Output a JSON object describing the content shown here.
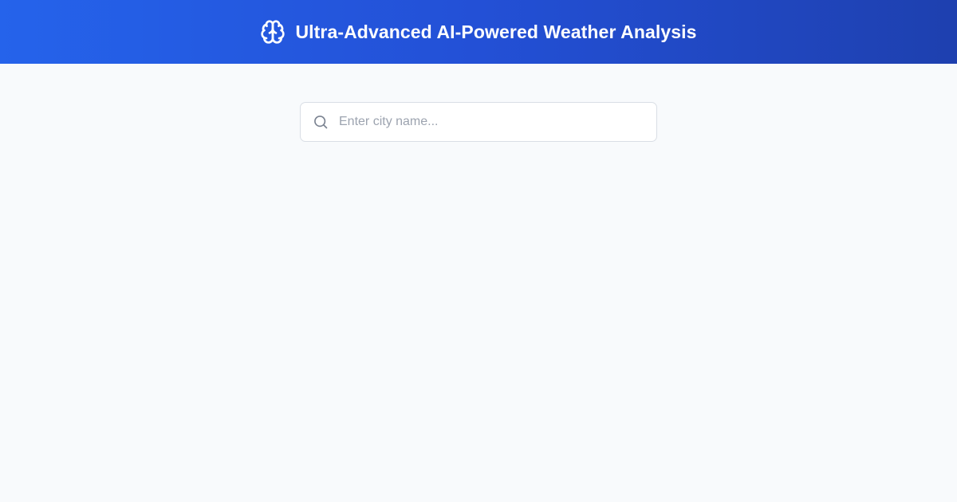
{
  "header": {
    "title": "Ultra-Advanced AI-Powered Weather Analysis",
    "icon": "brain-icon"
  },
  "search": {
    "icon": "search-icon",
    "value": "",
    "placeholder": "Enter city name..."
  },
  "colors": {
    "header_gradient_start": "#2563eb",
    "header_gradient_end": "#1e40af",
    "page_background": "#f8fafc",
    "placeholder_text": "#9ca3af"
  }
}
